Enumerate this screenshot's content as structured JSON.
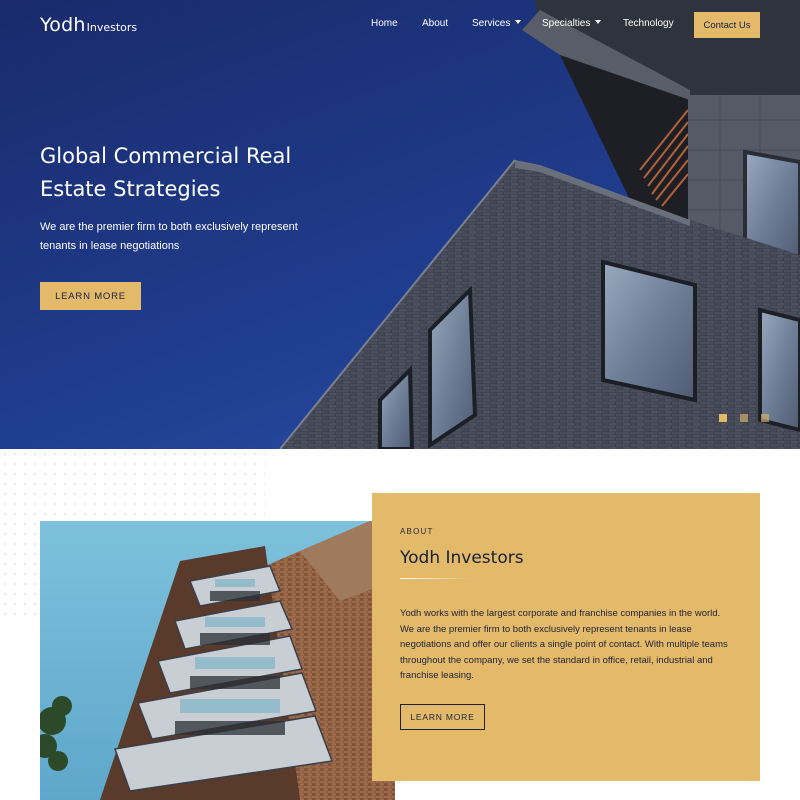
{
  "brand": {
    "name": "Yodh",
    "suffix": "Investors"
  },
  "nav": {
    "home": "Home",
    "about": "About",
    "services": "Services",
    "specialties": "Specialties",
    "technology": "Technology",
    "contact": "Contact Us"
  },
  "hero": {
    "title": "Global Commercial Real Estate Strategies",
    "subtitle": "We are the premier firm to both exclusively represent tenants in lease negotiations",
    "cta": "LEARN MORE",
    "slides": 3,
    "active_slide": 1
  },
  "about": {
    "eyebrow": "ABOUT",
    "title": "Yodh Investors",
    "body": "Yodh works with the largest corporate and franchise companies in the world. We are the premier firm to both exclusively represent tenants in lease negotiations and offer our clients a single point of contact. With multiple teams throughout the company, we set the standard in office, retail, industrial and franchise leasing.",
    "cta": "LEARN MORE"
  },
  "colors": {
    "hero_bg": "#1f3c8c",
    "accent": "#e3b96a",
    "text_dark": "#1f2236"
  }
}
